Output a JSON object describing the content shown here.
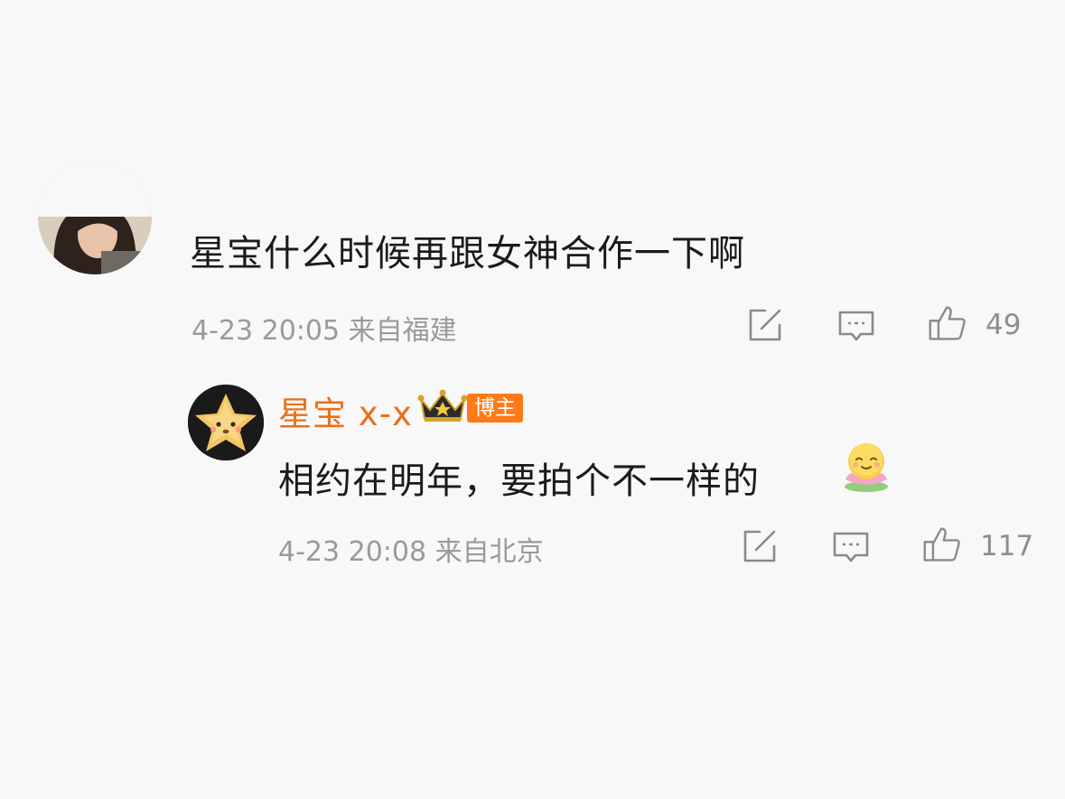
{
  "comment": {
    "text": "星宝什么时候再跟女神合作一下啊",
    "meta": "4-23 20:05 来自福建",
    "like_count": "49",
    "icons": {
      "share": "share-edit-icon",
      "reply": "comment-bubble-icon",
      "like": "thumbs-up-icon"
    }
  },
  "reply": {
    "author": "星宝 x-x",
    "badge": "博主",
    "text": "相约在明年，要拍个不一样的",
    "emoji": "smiling-lotus-emoji",
    "meta": "4-23 20:08 来自北京",
    "like_count": "117",
    "icons": {
      "share": "share-edit-icon",
      "reply": "comment-bubble-icon",
      "like": "thumbs-up-icon",
      "crown": "crown-icon"
    }
  },
  "colors": {
    "author": "#ec6f1c",
    "badge_bg": "#ff7a17",
    "meta": "#9a9a9a",
    "text": "#1b1b1b",
    "icon": "#8a8a8a"
  }
}
